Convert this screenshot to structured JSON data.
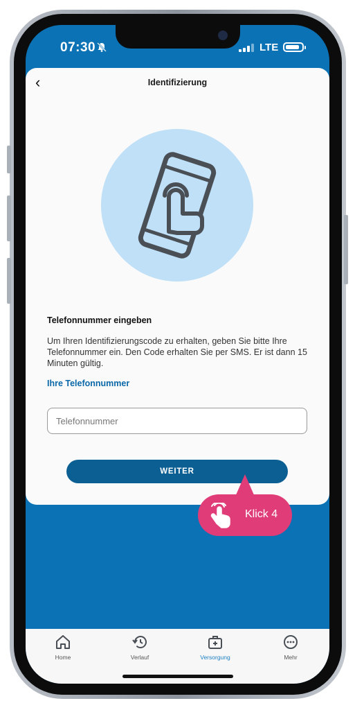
{
  "status_bar": {
    "time": "07:30",
    "network": "LTE",
    "battery_level": 0.85
  },
  "nav": {
    "title": "Identifizierung"
  },
  "content": {
    "heading": "Telefonnummer eingeben",
    "body": "Um Ihren Identifizierungscode zu erhalten, geben Sie bitte Ihre Telefonnummer ein. Den Code erhalten Sie per SMS. Er ist dann 15 Minuten gültig.",
    "link": "Ihre Telefonnummer",
    "phone_placeholder": "Telefonnummer",
    "phone_value": "",
    "button_label": "WEITER"
  },
  "tabbar": {
    "items": [
      {
        "label": "Home",
        "icon": "home-icon",
        "active": false
      },
      {
        "label": "Verlauf",
        "icon": "history-icon",
        "active": false
      },
      {
        "label": "Versorgung",
        "icon": "first-aid-kit-icon",
        "active": true
      },
      {
        "label": "Mehr",
        "icon": "more-icon",
        "active": false
      }
    ]
  },
  "callout": {
    "label": "Klick 4"
  },
  "colors": {
    "primary": "#0b72b5",
    "button": "#0b5f93",
    "link": "#0a68a8",
    "illustration_bg": "#bfe0f7",
    "active_tab": "#1d7fc2",
    "callout": "#e03d78"
  }
}
